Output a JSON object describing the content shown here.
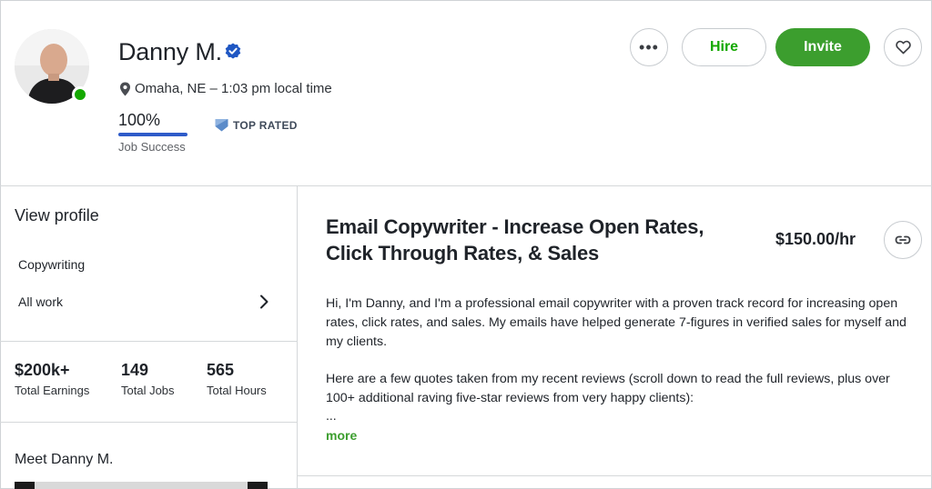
{
  "profile": {
    "name": "Danny M.",
    "location": "Omaha, NE – 1:03 pm local time",
    "job_success_value": "100%",
    "job_success_label": "Job Success",
    "job_success_fraction": 1.0,
    "badge": "TOP RATED",
    "online": true
  },
  "actions": {
    "more_label": "•••",
    "hire_label": "Hire",
    "invite_label": "Invite"
  },
  "sidebar": {
    "view_profile": "View profile",
    "items": [
      {
        "label": "Copywriting"
      },
      {
        "label": "All work"
      }
    ],
    "stats": [
      {
        "value": "$200k+",
        "label": "Total Earnings"
      },
      {
        "value": "149",
        "label": "Total Jobs"
      },
      {
        "value": "565",
        "label": "Total Hours"
      }
    ],
    "meet": "Meet Danny M."
  },
  "main": {
    "title": "Email Copywriter - Increase Open Rates, Click Through Rates, & Sales",
    "rate": "$150.00/hr",
    "paragraph1": "Hi, I'm Danny, and I'm a professional email copywriter with a proven track record for increasing open rates, click rates, and sales. My emails have helped generate 7-figures in verified sales for myself and my clients.",
    "paragraph2": "Here are a few quotes taken from my recent reviews (scroll down to read the full reviews, plus over 100+ additional raving five-star reviews from very happy clients):",
    "ellipsis": "...",
    "more_label": "more"
  },
  "colors": {
    "accent_green": "#3c9e2e",
    "online_green": "#14a800",
    "jss_blue": "#2e5bc9",
    "verified_blue": "#1f57c3"
  },
  "icons": [
    "verified-icon",
    "location-pin-icon",
    "top-rated-icon",
    "more-icon",
    "heart-icon",
    "chevron-right-icon",
    "link-icon"
  ]
}
